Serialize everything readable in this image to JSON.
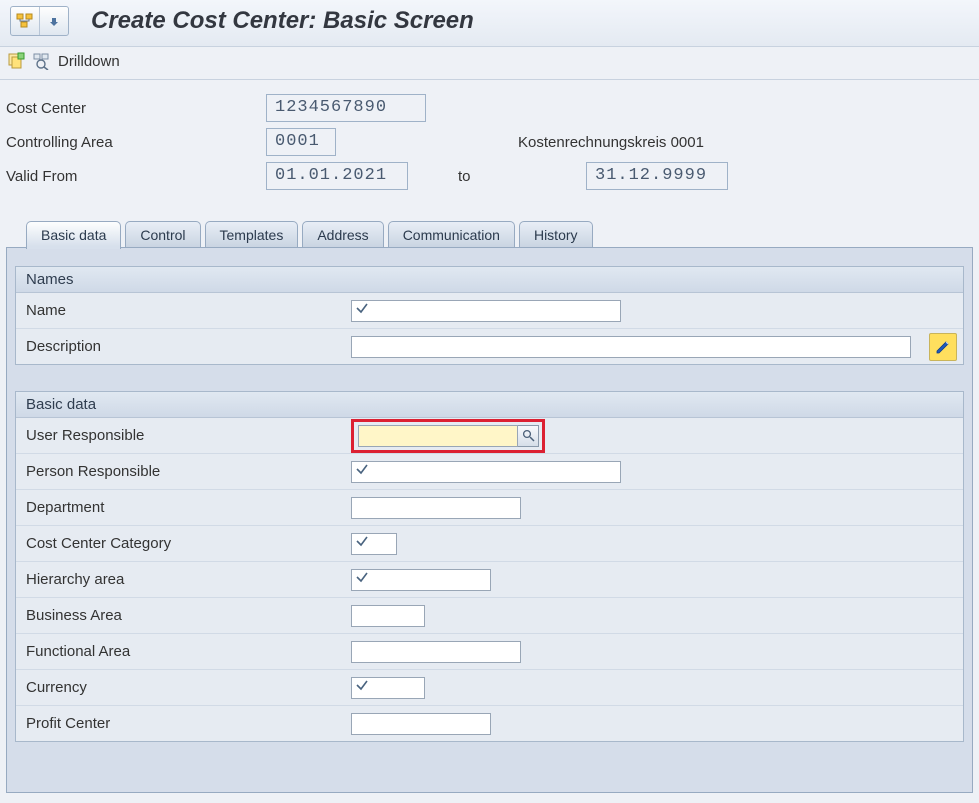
{
  "title": "Create Cost Center: Basic Screen",
  "toolbar": {
    "drilldown_label": "Drilldown"
  },
  "header": {
    "cost_center_label": "Cost Center",
    "cost_center_value": "1234567890",
    "controlling_area_label": "Controlling Area",
    "controlling_area_value": "0001",
    "controlling_area_text": "Kostenrechnungskreis 0001",
    "valid_from_label": "Valid From",
    "valid_from_value": "01.01.2021",
    "valid_to_label": "to",
    "valid_to_value": "31.12.9999"
  },
  "tabs": {
    "basic_data": "Basic data",
    "control": "Control",
    "templates": "Templates",
    "address": "Address",
    "communication": "Communication",
    "history": "History"
  },
  "group_names": {
    "names_title": "Names",
    "basic_data_title": "Basic data"
  },
  "names": {
    "name_label": "Name",
    "name_value": "",
    "description_label": "Description",
    "description_value": ""
  },
  "basic": {
    "user_responsible_label": "User Responsible",
    "user_responsible_value": "",
    "person_responsible_label": "Person Responsible",
    "person_responsible_value": "",
    "department_label": "Department",
    "department_value": "",
    "category_label": "Cost Center Category",
    "category_value": "",
    "hierarchy_label": "Hierarchy area",
    "hierarchy_value": "",
    "business_area_label": "Business Area",
    "business_area_value": "",
    "functional_area_label": "Functional Area",
    "functional_area_value": "",
    "currency_label": "Currency",
    "currency_value": "",
    "profit_center_label": "Profit Center",
    "profit_center_value": ""
  }
}
